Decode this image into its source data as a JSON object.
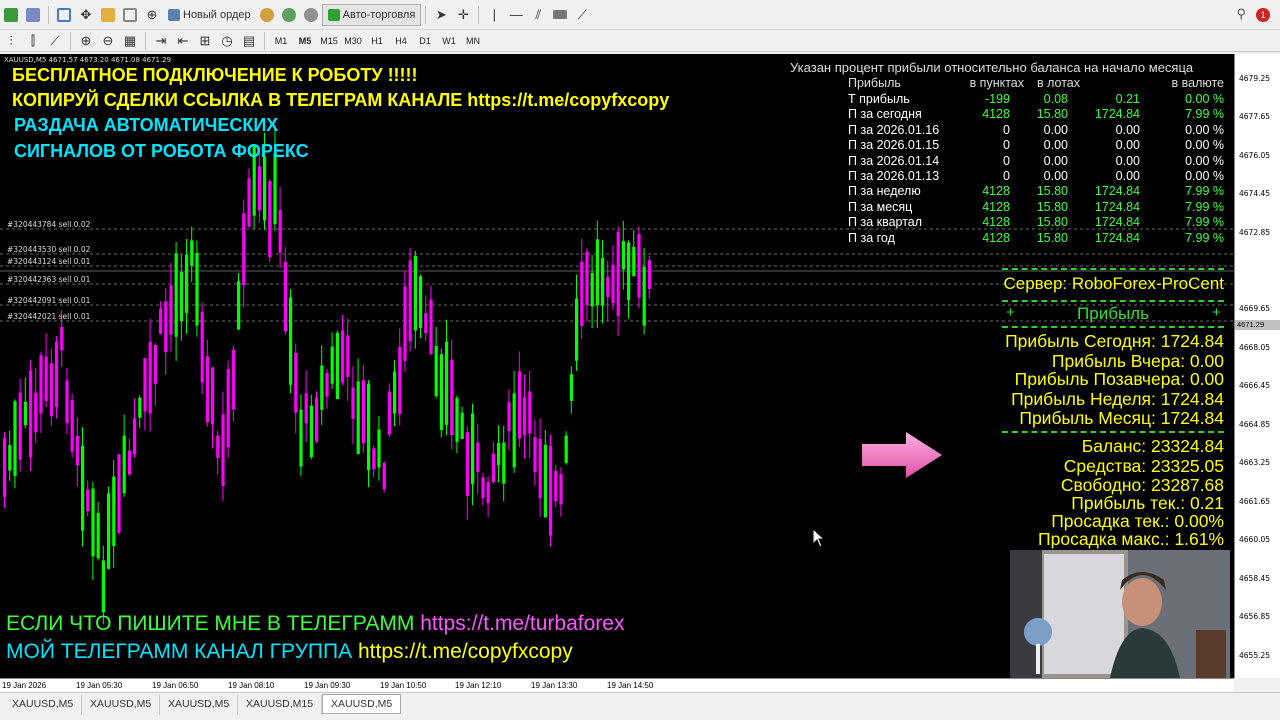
{
  "toolbar1": {
    "new_order": "Новый ордер",
    "auto_trading": "Авто-торговля",
    "notification_count": "1"
  },
  "toolbar2": {
    "timeframes": [
      "M1",
      "M5",
      "M15",
      "M30",
      "H1",
      "H4",
      "D1",
      "W1",
      "MN"
    ],
    "active_timeframe": "M5"
  },
  "chart": {
    "header": "XAUUSD,M5  4671.57 4673.20 4671.08 4671.29",
    "current_price": "4671.29",
    "price_labels": [
      "4679.25",
      "4677.65",
      "4676.05",
      "4674.45",
      "4672.85",
      "4669.65",
      "4668.05",
      "4666.45",
      "4664.85",
      "4663.25",
      "4661.65",
      "4660.05",
      "4658.45",
      "4656.85",
      "4655.25"
    ],
    "time_labels": [
      "19 Jan 2026",
      "19 Jan 05:30",
      "19 Jan 06:50",
      "19 Jan 08:10",
      "19 Jan 09:30",
      "19 Jan 10:50",
      "19 Jan 12:10",
      "19 Jan 13:30",
      "19 Jan 14:50"
    ],
    "orders": [
      "#320443784 sell 0.02",
      "#320443530 sell 0.02",
      "#320443124 sell 0.01",
      "#320442363 sell 0.01",
      "#320442091 sell 0.01",
      "#320442021 sell 0.01"
    ]
  },
  "overlay": {
    "line1": "БЕСПЛАТНОЕ ПОДКЛЮЧЕНИЕ К РОБОТУ !!!!!",
    "line2": "КОПИРУЙ СДЕЛКИ ССЫЛКА В ТЕЛЕГРАМ КАНАЛЕ https://t.me/copyfxcopy",
    "line3": "РАЗДАЧА АВТОМАТИЧЕСКИХ",
    "line4": "СИГНАЛОВ ОТ РОБОТА ФОРЕКС",
    "bottom1_text": "ЕСЛИ ЧТО ПИШИТЕ МНЕ В ТЕЛЕГРАММ ",
    "bottom1_link": "https://t.me/turbaforex",
    "bottom2_text": "МОЙ ТЕЛЕГРАММ КАНАЛ ГРУППА ",
    "bottom2_link": "https://t.me/copyfxcopy"
  },
  "stats": {
    "title": "Указан процент прибыли относительно баланса на начало месяца",
    "header": {
      "label": "Прибыль",
      "pts": "в пунктах",
      "lots": "в лотах",
      "val": "",
      "pct": "в валюте"
    },
    "rows": [
      {
        "label": "Т прибыль",
        "pts": "-199",
        "lots": "0.08",
        "val": "0.21",
        "pct": "0.00 %",
        "green": true
      },
      {
        "label": "П за сегодня",
        "pts": "4128",
        "lots": "15.80",
        "val": "1724.84",
        "pct": "7.99 %",
        "green": true
      },
      {
        "label": "П за 2026.01.16",
        "pts": "0",
        "lots": "0.00",
        "val": "0.00",
        "pct": "0.00 %",
        "green": false
      },
      {
        "label": "П за 2026.01.15",
        "pts": "0",
        "lots": "0.00",
        "val": "0.00",
        "pct": "0.00 %",
        "green": false
      },
      {
        "label": "П за 2026.01.14",
        "pts": "0",
        "lots": "0.00",
        "val": "0.00",
        "pct": "0.00 %",
        "green": false
      },
      {
        "label": "П за 2026.01.13",
        "pts": "0",
        "lots": "0.00",
        "val": "0.00",
        "pct": "0.00 %",
        "green": false
      },
      {
        "label": "П за неделю",
        "pts": "4128",
        "lots": "15.80",
        "val": "1724.84",
        "pct": "7.99 %",
        "green": true
      },
      {
        "label": "П за месяц",
        "pts": "4128",
        "lots": "15.80",
        "val": "1724.84",
        "pct": "7.99 %",
        "green": true
      },
      {
        "label": "П за квартал",
        "pts": "4128",
        "lots": "15.80",
        "val": "1724.84",
        "pct": "7.99 %",
        "green": true
      },
      {
        "label": "П за год",
        "pts": "4128",
        "lots": "15.80",
        "val": "1724.84",
        "pct": "7.99 %",
        "green": true
      }
    ]
  },
  "panel": {
    "server": "Сервер: RoboForex-ProCent",
    "profit_header": "Прибыль",
    "plus": "+",
    "profit_today": "Прибыль Сегодня: 1724.84",
    "profit_yesterday": "Прибыль Вчера: 0.00",
    "profit_day_before": "Прибыль Позавчера: 0.00",
    "profit_week": "Прибыль Неделя: 1724.84",
    "profit_month": "Прибыль Месяц: 1724.84",
    "balance": "Баланс: 23324.84",
    "equity": "Средства: 23325.05",
    "free": "Свободно: 23287.68",
    "profit_current": "Прибыль тек.:  0.21",
    "drawdown_current": "Просадка тек.:  0.00%",
    "drawdown_max": "Просадка макс.:  1.61%"
  },
  "tabs": [
    "XAUUSD,M5",
    "XAUUSD,M5",
    "XAUUSD,M5",
    "XAUUSD,M15",
    "XAUUSD,M5"
  ],
  "colors": {
    "bull": "#00ff00",
    "bear": "#ff00ff",
    "text_yellow": "#ffff00",
    "text_cyan": "#00e5ff",
    "text_green": "#3cff3c",
    "link_pink": "#ff55ff"
  }
}
